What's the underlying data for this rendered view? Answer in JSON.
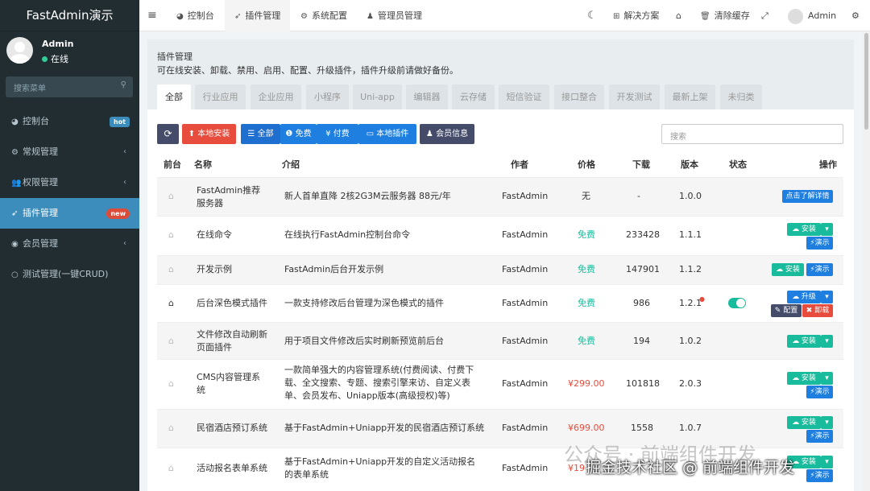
{
  "sidebar": {
    "brand": "FastAdmin演示",
    "user": {
      "name": "Admin",
      "status": "在线"
    },
    "search_placeholder": "搜索菜单",
    "items": [
      {
        "icon": "dashboard-icon",
        "glyph": "◕",
        "label": "控制台",
        "badge": "hot",
        "badge_color": "#3c8dbc"
      },
      {
        "icon": "cogs-icon",
        "glyph": "⚙",
        "label": "常规管理",
        "chevron": "‹"
      },
      {
        "icon": "users-icon",
        "glyph": "👥",
        "label": "权限管理",
        "chevron": "‹"
      },
      {
        "icon": "rocket-icon",
        "glyph": "➶",
        "label": "插件管理",
        "badge": "new",
        "badge_color": "#dd4b39"
      },
      {
        "icon": "user-circle-icon",
        "glyph": "◉",
        "label": "会员管理",
        "chevron": "‹"
      },
      {
        "icon": "circle-icon",
        "glyph": "○",
        "label": "测试管理(一键CRUD)"
      }
    ]
  },
  "topbar": {
    "toggle": "≡",
    "nav": [
      {
        "icon": "◕",
        "label": "控制台"
      },
      {
        "icon": "➶",
        "label": "插件管理"
      },
      {
        "icon": "⚙",
        "label": "系统配置"
      },
      {
        "icon": "♟",
        "label": "管理员管理"
      }
    ],
    "right": {
      "moon": "☾",
      "solution_icon": "⊞",
      "solution": "解决方案",
      "home": "⌂",
      "clear_icon": "🗑",
      "clear_cache": "清除缓存",
      "fullscreen": "⤢",
      "admin": "Admin",
      "settings": "⚙"
    }
  },
  "panel": {
    "title": "插件管理",
    "desc": "可在线安装、卸载、禁用、启用、配置、升级插件，插件升级前请做好备份。",
    "tabs": [
      "全部",
      "行业应用",
      "企业应用",
      "小程序",
      "Uni-app",
      "编辑器",
      "云存储",
      "短信验证",
      "接口整合",
      "开发测试",
      "最新上架",
      "未归类"
    ]
  },
  "toolbar": {
    "refresh": "⟳",
    "local_install": "⬆ 本地安装",
    "filters": [
      "☰ 全部",
      "❶ 免费",
      "¥ 付费",
      "▭ 本地插件"
    ],
    "member_info": "♟ 会员信息",
    "search_placeholder": "搜索"
  },
  "table": {
    "headers": [
      "前台",
      "名称",
      "介绍",
      "作者",
      "价格",
      "下载",
      "版本",
      "状态",
      "操作"
    ],
    "rows": [
      {
        "home": "⌂",
        "name": "FastAdmin推荐服务器",
        "intro": "新人首单直降 2核2G3M云服务器 88元/年",
        "author": "FastAdmin",
        "price": "无",
        "downloads": "-",
        "version": "1.0.0",
        "action": "点击了解详情"
      },
      {
        "home": "⌂",
        "name": "在线命令",
        "intro": "在线执行FastAdmin控制台命令",
        "author": "FastAdmin",
        "price": "免费",
        "downloads": "233428",
        "version": "1.1.1",
        "install": "☁ 安装",
        "demo": "⚡演示"
      },
      {
        "home": "⌂",
        "name": "开发示例",
        "intro": "FastAdmin后台开发示例",
        "author": "FastAdmin",
        "price": "免费",
        "downloads": "147901",
        "version": "1.1.2",
        "install": "☁ 安装",
        "demo": "⚡演示"
      },
      {
        "home": "⌂",
        "name": "后台深色模式插件",
        "intro": "一款支持修改后台管理为深色模式的插件",
        "author": "FastAdmin",
        "price": "免费",
        "downloads": "986",
        "version": "1.2.1",
        "upgrade": "☁ 升级",
        "config": "✎ 配置",
        "uninstall": "✖ 卸载"
      },
      {
        "home": "⌂",
        "name": "文件修改自动刷新页面插件",
        "intro": "用于项目文件修改后实时刷新预览前后台",
        "author": "FastAdmin",
        "price": "免费",
        "downloads": "194",
        "version": "1.0.2",
        "install": "☁ 安装"
      },
      {
        "home": "⌂",
        "name": "CMS内容管理系统",
        "intro": "一款简单强大的内容管理系统(付费阅读、付费下载、全文搜索、专题、搜索引擎来访、自定义表单、会员发布、Uniapp版本(高级授权)等)",
        "author": "FastAdmin",
        "price": "¥299.00",
        "downloads": "101818",
        "version": "2.0.3",
        "install": "☁ 安装",
        "demo": "⚡演示"
      },
      {
        "home": "⌂",
        "name": "民宿酒店预订系统",
        "intro": "基于FastAdmin+Uniapp开发的民宿酒店预订系统",
        "author": "FastAdmin",
        "price": "¥699.00",
        "downloads": "1558",
        "version": "1.0.7",
        "install": "☁ 安装",
        "demo": "⚡演示"
      },
      {
        "home": "⌂",
        "name": "活动报名表单系统",
        "intro": "基于FastAdmin+Uniapp开发的自定义活动报名的表单系统",
        "author": "FastAdmin",
        "price": "¥19",
        "downloads": "",
        "version": "",
        "install": "☁ 安装",
        "demo": "⚡演示"
      }
    ]
  },
  "watermark": {
    "line1": "公众号 · 前端组件开发",
    "line2": "掘金技术社区 @ 前端组件开发"
  },
  "colors": {
    "sidebar": "#222d32",
    "accent": "#3c8dbc",
    "green": "#18bc9c",
    "red": "#e74c3c",
    "navy": "#444c6a",
    "blue": "#1f7fe0"
  }
}
